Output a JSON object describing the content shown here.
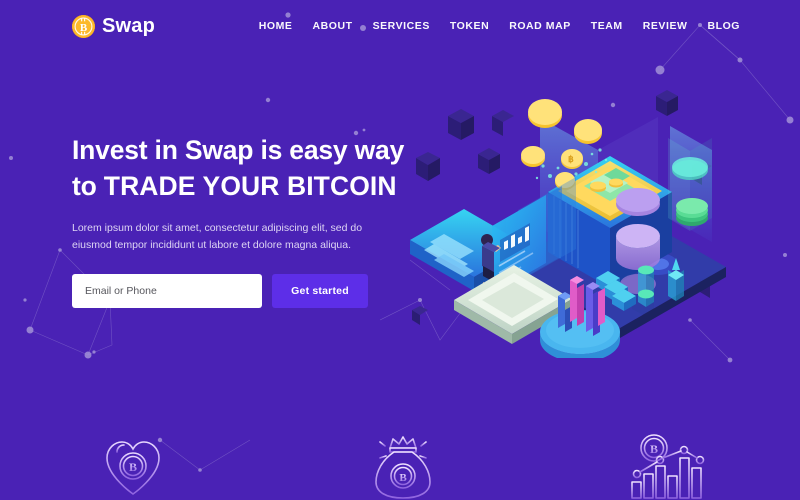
{
  "brand": {
    "name": "Swap",
    "logo_icon": "bitcoin-coin-icon",
    "logo_color": "#fcb92b"
  },
  "nav": {
    "items": [
      {
        "label": "HOME"
      },
      {
        "label": "ABOUT"
      },
      {
        "label": "SERVICES"
      },
      {
        "label": "TOKEN"
      },
      {
        "label": "ROAD MAP"
      },
      {
        "label": "TEAM"
      },
      {
        "label": "REVIEW"
      },
      {
        "label": "BLOG"
      }
    ]
  },
  "hero": {
    "title_line1": "Invest in Swap is easy way",
    "title_line2_prefix": "to ",
    "title_line2_strong": "TRADE YOUR BITCOIN",
    "paragraph": "Lorem ipsum dolor sit amet, consectetur adipiscing elit, sed do eiusmod tempor incididunt ut labore et dolore magna aliqua.",
    "email_placeholder": "Email or Phone",
    "email_value": "",
    "cta_label": "Get started"
  },
  "illustration": {
    "name": "isometric-crypto-trading-illustration"
  },
  "features": [
    {
      "icon": "heart-bitcoin-icon"
    },
    {
      "icon": "money-bag-bitcoin-icon"
    },
    {
      "icon": "bitcoin-bar-chart-icon"
    }
  ],
  "colors": {
    "background": "#4a22b5",
    "accent_button": "#5d2ee8",
    "logo_gold": "#fcb92b",
    "text_primary": "#ffffff",
    "text_muted": "#ded5f4"
  }
}
